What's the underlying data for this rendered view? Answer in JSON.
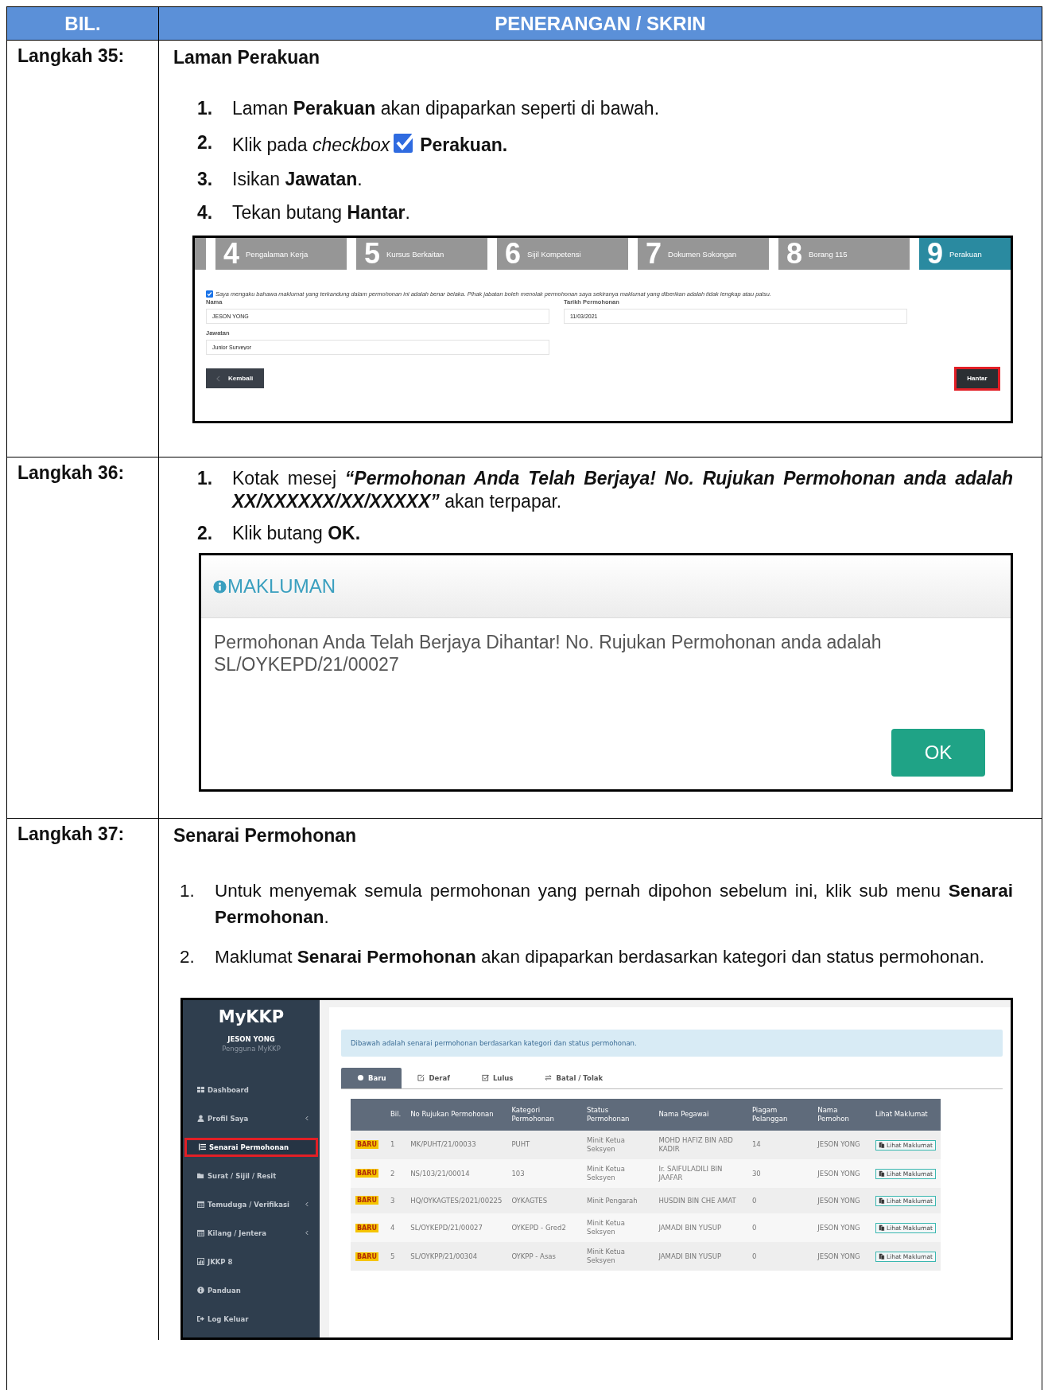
{
  "header": {
    "columns": [
      "BIL.",
      "PENERANGAN / SKRIN"
    ]
  },
  "steps": [
    {
      "kind": "form",
      "label": "Langkah 35:",
      "title": "Laman Perakuan",
      "bold_numbers": true,
      "instructions": [
        {
          "number": "1.",
          "text": "Laman **Perakuan** akan dipaparkan seperti di bawah."
        },
        {
          "number": "2.",
          "text": "Klik pada *checkbox*",
          "checkbox_icon": true,
          "text_after": "Perakuan."
        },
        {
          "number": "3.",
          "text": "Isikan **Jawatan**."
        },
        {
          "number": "4.",
          "text": "Tekan butang **Hantar**."
        }
      ],
      "screen": {
        "wizard": [
          {
            "number": "4",
            "label": "Pengalaman Kerja",
            "selected": false
          },
          {
            "number": "5",
            "label": "Kursus Berkaitan",
            "selected": false
          },
          {
            "number": "6",
            "label": "Sijil Kompetensi",
            "selected": false
          },
          {
            "number": "7",
            "label": "Dokumen Sokongan",
            "selected": false
          },
          {
            "number": "8",
            "label": "Borang 115",
            "selected": false
          },
          {
            "number": "9",
            "label": "Perakuan",
            "selected": true
          }
        ],
        "declaration": {
          "checked": true,
          "text": "Saya mengaku bahawa maklumat yang terkandung dalam permohonan ini adalah benar belaka. Pihak jabatan boleh menolak permohonan saya sekiranya maklumat yang diberikan adalah tidak lengkap atau palsu."
        },
        "fields": [
          {
            "label": "Nama",
            "value": "JESON YONG"
          },
          {
            "label": "Tarikh Permohonan",
            "value": "11/03/2021"
          },
          {
            "label": "Jawatan",
            "value": "Junior Surveyor"
          }
        ],
        "back_button": "Kembali",
        "submit_button": {
          "label": "Hantar",
          "highlighted": true
        }
      }
    },
    {
      "kind": "dialog",
      "label": "Langkah 36:",
      "bold_numbers": true,
      "instructions": [
        {
          "number": "1.",
          "text": "Kotak mesej *“Permohonan Anda Telah Berjaya! No. Rujukan Permohonan anda adalah XX/XXXXXX/XX/XXXXX”* akan terpapar."
        },
        {
          "number": "2.",
          "text": "Klik butang **OK.**"
        }
      ],
      "screen": {
        "title": "MAKLUMAN",
        "message": "Permohonan Anda Telah Berjaya Dihantar! No. Rujukan Permohonan anda adalah SL/OYKEPD/21/00027",
        "button": "OK"
      }
    },
    {
      "kind": "list",
      "label": "Langkah 37:",
      "title": "Senarai Permohonan",
      "bold_numbers": false,
      "instructions": [
        {
          "number": "1.",
          "text": "Untuk menyemak semula permohonan yang pernah dipohon sebelum ini, klik sub menu **Senarai Permohonan**."
        },
        {
          "number": "2.",
          "text": "Maklumat **Senarai Permohonan** akan dipaparkan berdasarkan kategori dan status permohonan."
        }
      ],
      "screen": {
        "brand": "MyKKP",
        "user": "JESON YONG",
        "role": "Pengguna MyKKP",
        "menu": [
          {
            "label": "Dashboard",
            "submenu": false,
            "selected": false,
            "highlighted": false
          },
          {
            "label": "Profil Saya",
            "submenu": true,
            "selected": false,
            "highlighted": false
          },
          {
            "label": "Senarai Permohonan",
            "submenu": false,
            "selected": true,
            "highlighted": true
          },
          {
            "label": "Surat / Sijil / Resit",
            "submenu": false,
            "selected": false,
            "highlighted": false
          },
          {
            "label": "Temuduga / Verifikasi",
            "submenu": true,
            "selected": false,
            "highlighted": false
          },
          {
            "label": "Kilang / Jentera",
            "submenu": true,
            "selected": false,
            "highlighted": false
          },
          {
            "label": "JKKP 8",
            "submenu": false,
            "selected": false,
            "highlighted": false
          },
          {
            "label": "Panduan",
            "submenu": false,
            "selected": false,
            "highlighted": false
          },
          {
            "label": "Log Keluar",
            "submenu": false,
            "selected": false,
            "highlighted": false
          }
        ],
        "alert": "Dibawah adalah senarai permohonan berdasarkan kategori dan status permohonan.",
        "tabs": [
          {
            "label": "Baru",
            "selected": true
          },
          {
            "label": "Deraf",
            "selected": false
          },
          {
            "label": "Lulus",
            "selected": false
          },
          {
            "label": "Batal / Tolak",
            "selected": false
          }
        ],
        "table": {
          "columns": [
            "Bil.",
            "No Rujukan Permohonan",
            "Kategori Permohonan",
            "Status Permohonan",
            "Nama Pegawai",
            "Piagam Pelanggan",
            "Nama Pemohon",
            "Lihat Maklumat"
          ],
          "rows": [
            {
              "badge": "BARU",
              "cells": [
                "1",
                "MK/PUHT/21/00033",
                "PUHT",
                "Minit Ketua Seksyen",
                "MOHD HAFIZ BIN ABD KADIR",
                "14",
                "JESON YONG"
              ],
              "action": "Lihat Maklumat"
            },
            {
              "badge": "BARU",
              "cells": [
                "2",
                "NS/103/21/00014",
                "103",
                "Minit Ketua Seksyen",
                "Ir. SAIFULADILI BIN JAAFAR",
                "30",
                "JESON YONG"
              ],
              "action": "Lihat Maklumat"
            },
            {
              "badge": "BARU",
              "cells": [
                "3",
                "HQ/OYKAGTES/2021/00225",
                "OYKAGTES",
                "Minit Pengarah",
                "HUSDIN BIN CHE AMAT",
                "0",
                "JESON YONG"
              ],
              "action": "Lihat Maklumat"
            },
            {
              "badge": "BARU",
              "cells": [
                "4",
                "SL/OYKEPD/21/00027",
                "OYKEPD - Gred2",
                "Minit Ketua Seksyen",
                "JAMADI BIN YUSUP",
                "0",
                "JESON YONG"
              ],
              "action": "Lihat Maklumat"
            },
            {
              "badge": "BARU",
              "cells": [
                "5",
                "SL/OYKPP/21/00304",
                "OYKPP - Asas",
                "Minit Ketua Seksyen",
                "JAMADI BIN YUSUP",
                "0",
                "JESON YONG"
              ],
              "action": "Lihat Maklumat"
            }
          ]
        }
      }
    }
  ]
}
